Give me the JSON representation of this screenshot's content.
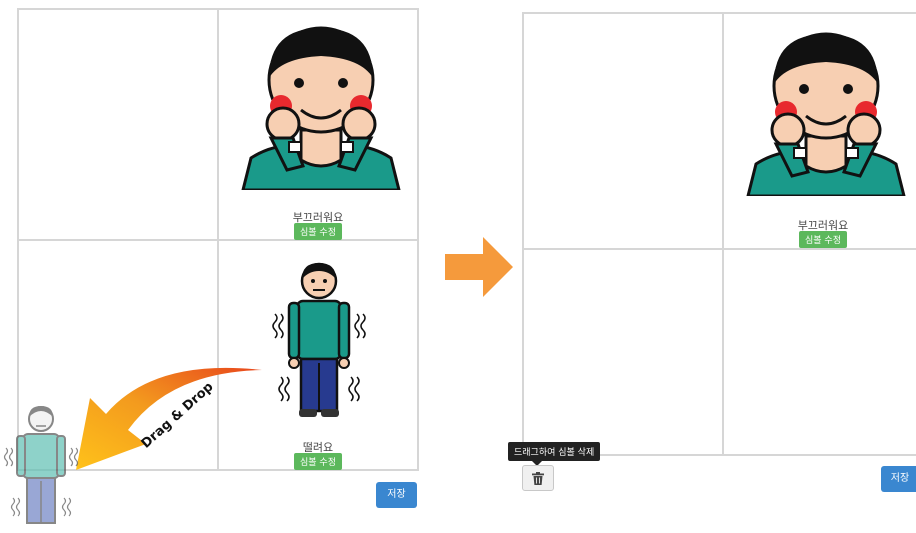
{
  "before": {
    "symbols": [
      {
        "label": "부끄러워요",
        "edit_label": "심볼 수정"
      },
      {
        "label": "떨려요",
        "edit_label": "심볼 수정"
      }
    ],
    "drag_annotation": "Drag & Drop",
    "save_label": "저장"
  },
  "after": {
    "symbols": [
      {
        "label": "부끄러워요",
        "edit_label": "심볼 수정"
      }
    ],
    "delete_tooltip": "드래그하여 심볼 삭제",
    "trash_icon": "trash-icon",
    "save_label": "저장"
  },
  "colors": {
    "accent_green": "#5cb85c",
    "accent_blue": "#3a87d0",
    "arrow_orange": "#f59a3c",
    "shirt_teal": "#1a9a8a"
  }
}
